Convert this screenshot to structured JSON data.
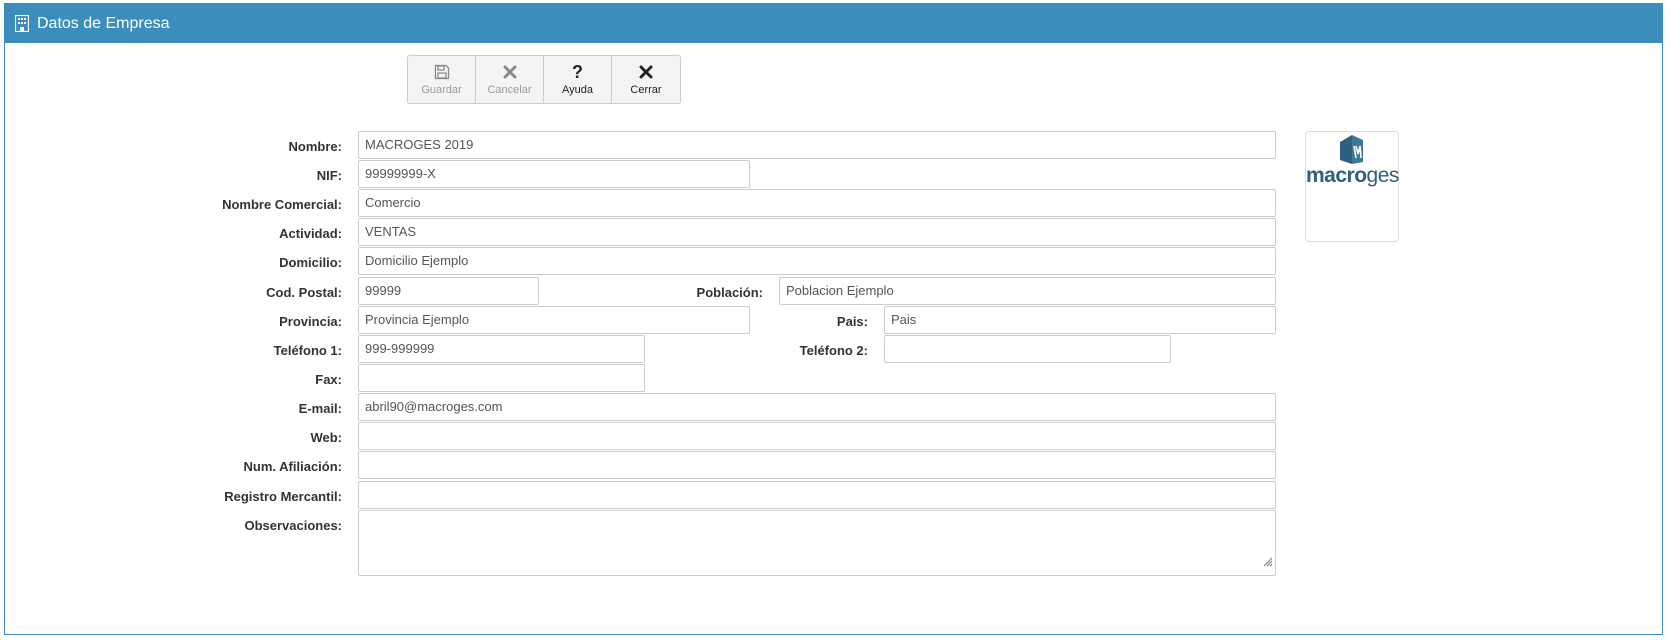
{
  "header": {
    "title": "Datos de Empresa",
    "icon": "building-icon",
    "color": "#3c8dbc"
  },
  "toolbar": {
    "save": {
      "label": "Guardar",
      "icon": "floppy-disk-icon",
      "enabled": false
    },
    "cancel": {
      "label": "Cancelar",
      "icon": "close-icon",
      "enabled": false
    },
    "help": {
      "label": "Ayuda",
      "icon": "question-icon",
      "enabled": true
    },
    "close": {
      "label": "Cerrar",
      "icon": "close-icon",
      "enabled": true
    }
  },
  "form": {
    "nombre": {
      "label": "Nombre:",
      "value": "MACROGES 2019"
    },
    "nif": {
      "label": "NIF:",
      "value": "99999999-X"
    },
    "nombre_comercial": {
      "label": "Nombre Comercial:",
      "value": "Comercio"
    },
    "actividad": {
      "label": "Actividad:",
      "value": "VENTAS"
    },
    "domicilio": {
      "label": "Domicilio:",
      "value": "Domicilio Ejemplo"
    },
    "cod_postal": {
      "label": "Cod. Postal:",
      "value": "99999"
    },
    "poblacion": {
      "label": "Población:",
      "value": "Poblacion Ejemplo"
    },
    "provincia": {
      "label": "Provincia:",
      "value": "Provincia Ejemplo"
    },
    "pais": {
      "label": "Pais:",
      "value": "Pais"
    },
    "telefono1": {
      "label": "Teléfono 1:",
      "value": "999-999999"
    },
    "telefono2": {
      "label": "Teléfono 2:",
      "value": ""
    },
    "fax": {
      "label": "Fax:",
      "value": ""
    },
    "email": {
      "label": "E-mail:",
      "value": "abril90@macroges.com"
    },
    "web": {
      "label": "Web:",
      "value": ""
    },
    "num_afiliacion": {
      "label": "Num. Afiliación:",
      "value": ""
    },
    "registro_mercantil": {
      "label": "Registro Mercantil:",
      "value": ""
    },
    "observaciones": {
      "label": "Observaciones:",
      "value": ""
    }
  },
  "logo": {
    "text_bold": "macro",
    "text_light": "ges"
  }
}
